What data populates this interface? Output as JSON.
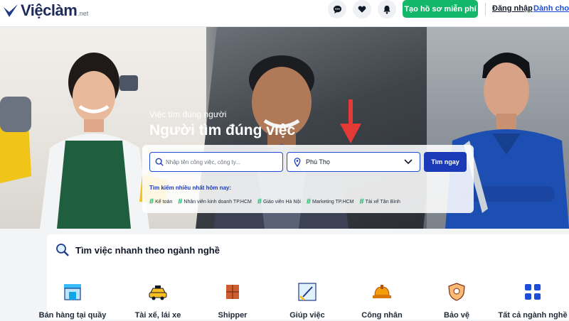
{
  "header": {
    "logo_text": "Việclàm",
    "logo_suffix": ".net",
    "create_cv_button": "Tạo hồ sơ miễn phí",
    "login_link": "Đăng nhập",
    "employer_link": "Dành cho n",
    "icons": [
      "chat-icon",
      "heart-icon",
      "bell-icon"
    ]
  },
  "hero": {
    "tagline_small": "Việc tìm đúng người",
    "tagline_big": "Người tìm đúng việc",
    "search": {
      "keyword_placeholder": "Nhập tên công việc, công ty...",
      "location_value": "Phú Thọ",
      "search_button": "Tìm ngay"
    },
    "popular_label": "Tìm kiếm nhiều nhất hôm nay:",
    "popular_tags": [
      "Kế toán",
      "Nhân viên kinh doanh TP.HCM",
      "Giáo viên Hà Nội",
      "Marketing TP.HCM",
      "Tài xế Tân Bình"
    ]
  },
  "categories": {
    "title": "Tìm việc nhanh theo ngành nghề",
    "items": [
      {
        "label": "Bán hàng tại quầy",
        "icon": "shop-icon"
      },
      {
        "label": "Tài xế, lái xe",
        "icon": "taxi-icon"
      },
      {
        "label": "Shipper",
        "icon": "package-icon"
      },
      {
        "label": "Giúp việc",
        "icon": "cleaning-icon"
      },
      {
        "label": "Công nhân",
        "icon": "hardhat-icon"
      },
      {
        "label": "Bảo vệ",
        "icon": "security-badge-icon"
      },
      {
        "label": "Tất cả ngành nghề",
        "icon": "grid-icon"
      }
    ]
  },
  "colors": {
    "brand_blue": "#1a3ab8",
    "brand_green": "#12b76a",
    "arrow_red": "#e53935"
  }
}
